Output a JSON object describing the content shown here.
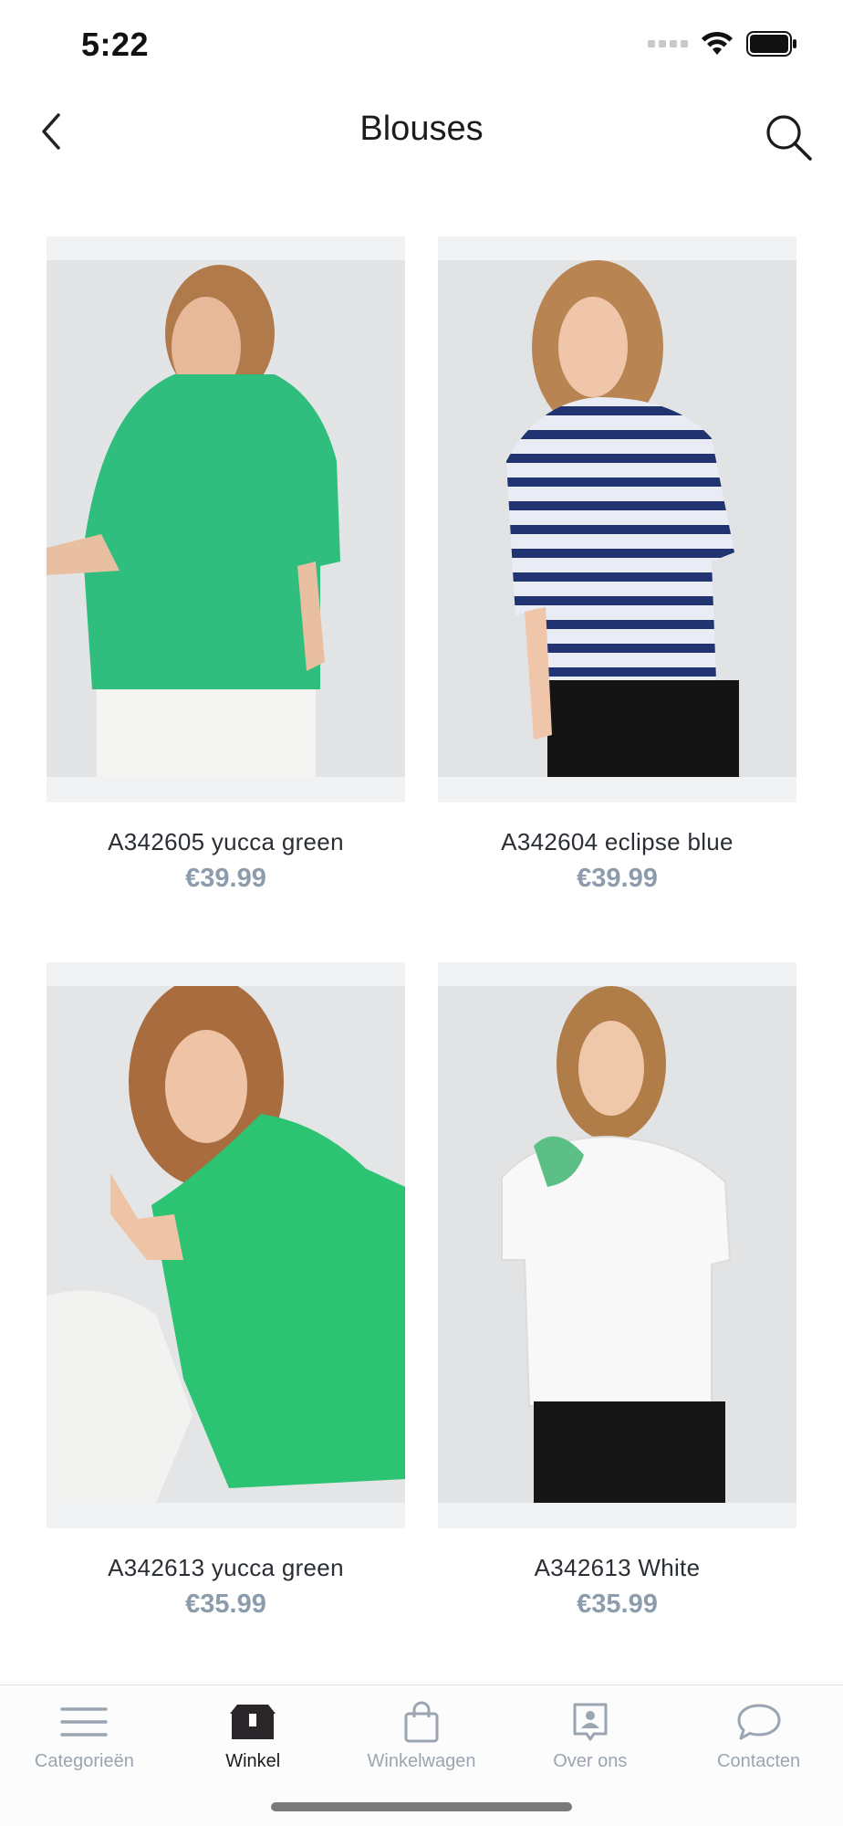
{
  "status": {
    "time": "5:22"
  },
  "nav": {
    "title": "Blouses",
    "back_icon": "chevron-left-icon",
    "search_icon": "search-icon"
  },
  "products": [
    {
      "name": "A342605 yucca green",
      "price": "€39.99",
      "color": "#2fbe7e",
      "image": "green blouse back view"
    },
    {
      "name": "A342604 eclipse blue",
      "price": "€39.99",
      "color": "#1f2f6e",
      "image": "blue striped blouse"
    },
    {
      "name": "A342613 yucca green",
      "price": "€35.99",
      "color": "#2cc472",
      "image": "green shirt seated model"
    },
    {
      "name": "A342613 White",
      "price": "€35.99",
      "color": "#f7f7f7",
      "image": "white shirt standing model"
    }
  ],
  "tabs": [
    {
      "label": "Categorieën",
      "icon": "menu-icon",
      "active": false
    },
    {
      "label": "Winkel",
      "icon": "store-icon",
      "active": true
    },
    {
      "label": "Winkelwagen",
      "icon": "shopping-bag-icon",
      "active": false
    },
    {
      "label": "Over ons",
      "icon": "contact-card-icon",
      "active": false
    },
    {
      "label": "Contacten",
      "icon": "chat-bubble-icon",
      "active": false
    }
  ],
  "colors": {
    "price": "#8d9cad",
    "tab_inactive": "#9aa5b1",
    "tab_active": "#1c1c1c",
    "image_bg": "#f1f2f3"
  }
}
